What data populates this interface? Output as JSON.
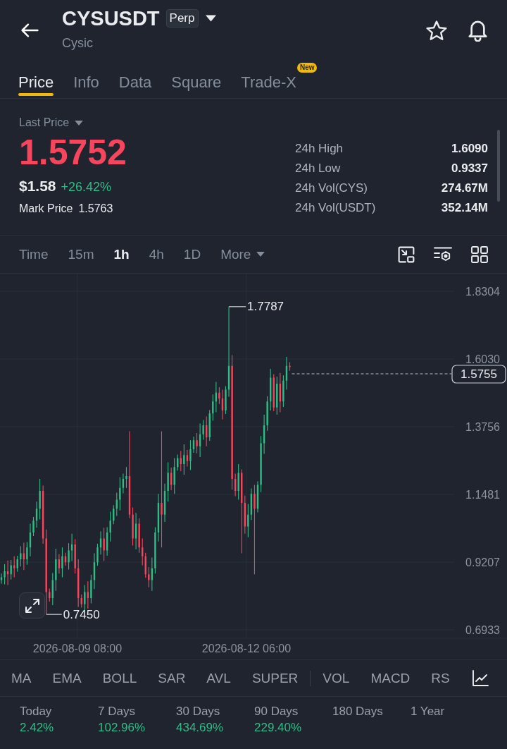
{
  "header": {
    "symbol": "CYSUSDT",
    "contract_badge": "Perp",
    "name": "Cysic"
  },
  "tabs": [
    {
      "label": "Price",
      "selected": true
    },
    {
      "label": "Info",
      "selected": false
    },
    {
      "label": "Data",
      "selected": false
    },
    {
      "label": "Square",
      "selected": false
    },
    {
      "label": "Trade-X",
      "selected": false,
      "badge": "New"
    }
  ],
  "price_panel": {
    "price_type": "Last Price",
    "last_price": "1.5752",
    "last_price_up": false,
    "usd_price": "$1.58",
    "change": "+26.42%",
    "change_up": true,
    "mark_price_label": "Mark Price",
    "mark_price": "1.5763",
    "stats": [
      {
        "label": "24h High",
        "value": "1.6090"
      },
      {
        "label": "24h Low",
        "value": "0.9337"
      },
      {
        "label": "24h Vol(CYS)",
        "value": "274.67M"
      },
      {
        "label": "24h Vol(USDT)",
        "value": "352.14M"
      }
    ]
  },
  "timeframes": [
    {
      "kind": "interval",
      "label": "Time",
      "selected": false
    },
    {
      "kind": "interval",
      "label": "15m",
      "selected": false
    },
    {
      "kind": "interval",
      "label": "1h",
      "selected": true
    },
    {
      "kind": "interval",
      "label": "4h",
      "selected": false
    },
    {
      "kind": "interval",
      "label": "1D",
      "selected": false
    },
    {
      "kind": "menu",
      "label": "More",
      "selected": false
    }
  ],
  "chart": {
    "price_labels": [
      "1.8304",
      "1.6030",
      "1.3756",
      "1.1481",
      "0.9207",
      "0.6933"
    ],
    "high_marker": "1.7787",
    "low_marker": "0.7450",
    "current_price": "1.5755",
    "time_labels": [
      "2026-08-09 08:00",
      "2026-08-12 06:00"
    ]
  },
  "indicators": {
    "main": [
      "MA",
      "EMA",
      "BOLL",
      "SAR",
      "AVL",
      "SUPER"
    ],
    "sub": [
      "VOL",
      "MACD",
      "RS"
    ]
  },
  "performance": [
    {
      "period": "Today",
      "change": "2.42%",
      "positive": true
    },
    {
      "period": "7 Days",
      "change": "102.96%",
      "positive": true
    },
    {
      "period": "30 Days",
      "change": "434.69%",
      "positive": true
    },
    {
      "period": "90 Days",
      "change": "229.40%",
      "positive": true
    },
    {
      "period": "180 Days"
    },
    {
      "period": "1 Year"
    }
  ]
}
